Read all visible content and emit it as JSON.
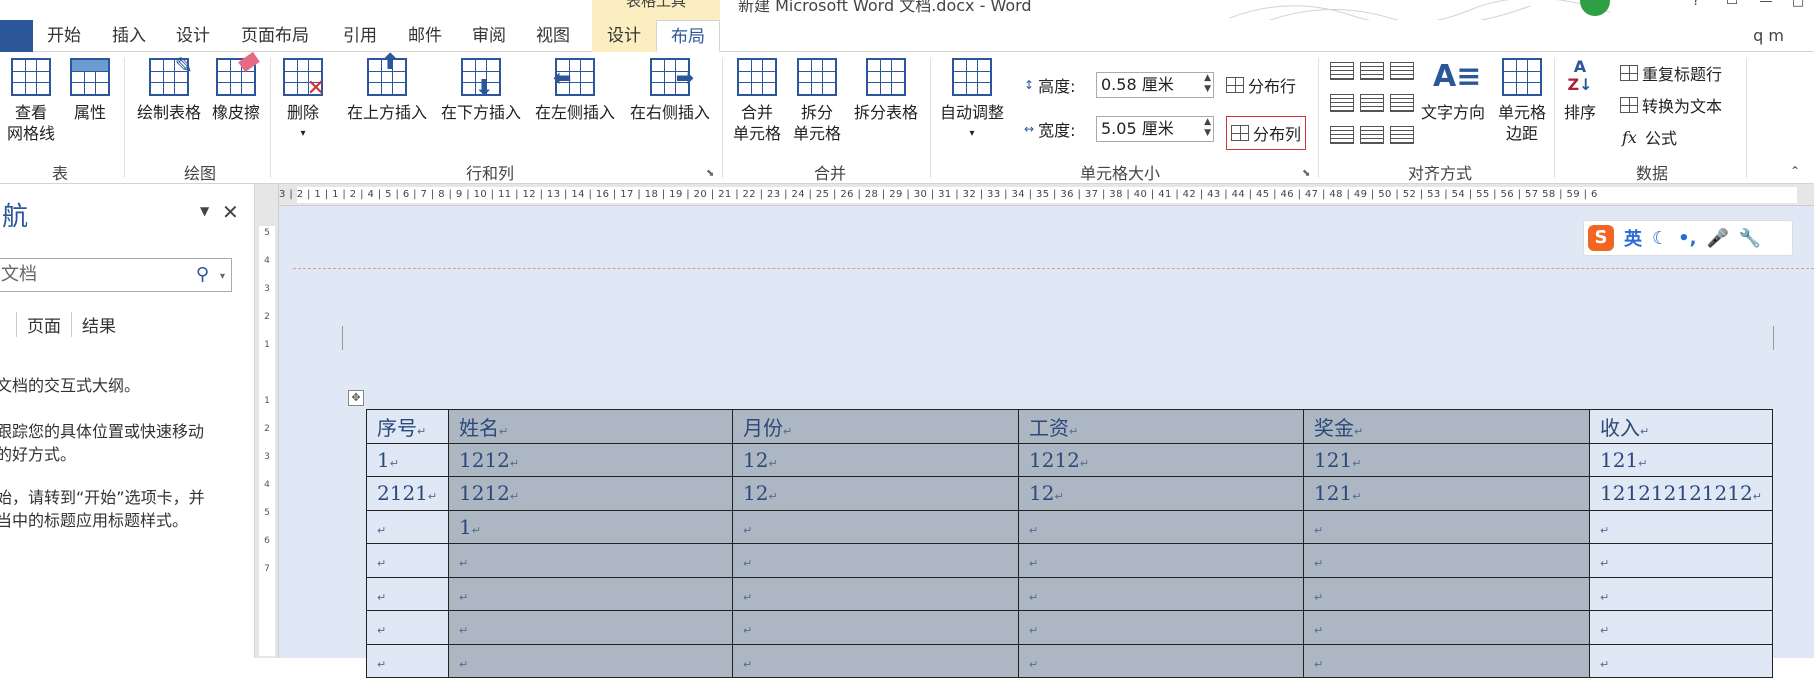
{
  "window": {
    "title": "新建 Microsoft Word 文档.docx - Word",
    "context_tools_label": "表格工具",
    "user": "q m"
  },
  "tabs": [
    "开始",
    "插入",
    "设计",
    "页面布局",
    "引用",
    "邮件",
    "审阅",
    "视图"
  ],
  "context_tabs": {
    "design": "设计",
    "layout": "布局"
  },
  "ribbon": {
    "table_group": {
      "label": "表",
      "view_gridlines": [
        "查看",
        "网格线"
      ],
      "properties": "属性"
    },
    "draw_group": {
      "label": "绘图",
      "draw_table": "绘制表格",
      "eraser": "橡皮擦"
    },
    "rows_cols_group": {
      "label": "行和列",
      "delete": "删除",
      "insert_above": "在上方插入",
      "insert_below": "在下方插入",
      "insert_left": "在左侧插入",
      "insert_right": "在右侧插入"
    },
    "merge_group": {
      "label": "合并",
      "merge_cells": [
        "合并",
        "单元格"
      ],
      "split_cells": [
        "拆分",
        "单元格"
      ],
      "split_table": "拆分表格"
    },
    "cell_size_group": {
      "label": "单元格大小",
      "autofit": "自动调整",
      "height_label": "高度:",
      "height_value": "0.58 厘米",
      "width_label": "宽度:",
      "width_value": "5.05 厘米",
      "distribute_rows": "分布行",
      "distribute_cols": "分布列"
    },
    "alignment_group": {
      "label": "对齐方式",
      "text_direction": "文字方向",
      "cell_margins": [
        "单元格",
        "边距"
      ]
    },
    "data_group": {
      "label": "数据",
      "sort": "排序",
      "repeat_header": "重复标题行",
      "convert_to_text": "转换为文本",
      "formula": "公式",
      "formula_symbol": "fx"
    }
  },
  "ruler": {
    "horizontal": "3 | 2 | 1   |   1 | 2 |   4 | 5 | 6 | 7 | 8 | 9 | 10 | 11 | 12 | 13 | 14    | 16 | 17 | 18 | 19 | 20 | 21 | 22 | 23 | 24 | 25 | 26     | 28 | 29 | 30 | 31 | 32 | 33 | 34 | 35 | 36 | 37 | 38     | 40 | 41 | 42 | 43 | 44 | 45 | 46 | 47 | 48 | 49 | 50     | 52 | 53 | 54 | 55 | 56 | 57    58 | 59 | 6",
    "vertical": [
      "5",
      "4",
      "3",
      "2",
      "1",
      "",
      "1",
      "2",
      "3",
      "4",
      "5",
      "6",
      "7"
    ],
    "corner": "L"
  },
  "nav_pane": {
    "title": "航",
    "search_placeholder": "文档",
    "tabs": [
      "",
      "页面",
      "结果"
    ],
    "text1": "文档的交互式大纲。",
    "text2": [
      "跟踪您的具体位置或快速移动",
      "的好方式。"
    ],
    "text3": [
      "始，请转到“开始”选项卡，并",
      "当中的标题应用标题样式。"
    ]
  },
  "ime": {
    "logo": "S",
    "lang": "英",
    "icons": [
      "moon-icon",
      "punct-icon",
      "mic-icon",
      "wrench-icon"
    ]
  },
  "table": {
    "headers": [
      "序号",
      "姓名",
      "月份",
      "工资",
      "奖金",
      "收入"
    ],
    "rows": [
      [
        "1",
        "1212",
        "12",
        "1212",
        "121",
        "121"
      ],
      [
        "2121",
        "1212",
        "12",
        "12",
        "121",
        "121212121212"
      ],
      [
        "",
        "1",
        "",
        "",
        "",
        ""
      ],
      [
        "",
        "",
        "",
        "",
        "",
        ""
      ],
      [
        "",
        "",
        "",
        "",
        "",
        ""
      ],
      [
        "",
        "",
        "",
        "",
        "",
        ""
      ],
      [
        "",
        "",
        "",
        "",
        "",
        ""
      ]
    ]
  }
}
